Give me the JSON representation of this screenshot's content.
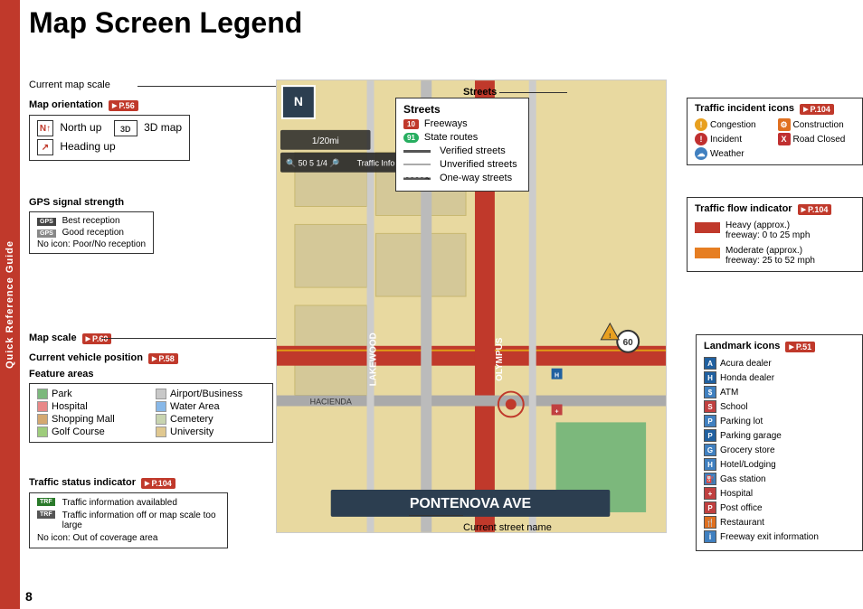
{
  "page": {
    "title": "Map Screen Legend",
    "page_number": "8",
    "side_tab": "Quick Reference Guide"
  },
  "left_panel": {
    "current_map_scale_label": "Current map scale",
    "map_orientation_label": "Map orientation",
    "map_orientation_ref": "P.56",
    "north_up_label": "North up",
    "three_d_map_label": "3D map",
    "heading_up_label": "Heading up",
    "gps_signal_label": "GPS signal strength",
    "gps_best": "Best reception",
    "gps_good": "Good reception",
    "gps_none": "No icon: Poor/No reception",
    "map_scale_label": "Map scale",
    "map_scale_ref": "P.60",
    "vehicle_position_label": "Current vehicle position",
    "vehicle_position_ref": "P.58",
    "feature_areas_label": "Feature areas",
    "features": [
      {
        "name": "Park",
        "color": "#7cb87c"
      },
      {
        "name": "Airport/Business",
        "color": "#c8c8c8"
      },
      {
        "name": "Hospital",
        "color": "#e88888"
      },
      {
        "name": "Water Area",
        "color": "#88b8e8"
      },
      {
        "name": "Shopping Mall",
        "color": "#d4a870"
      },
      {
        "name": "Cemetery",
        "color": "#c8d4b0"
      },
      {
        "name": "Golf Course",
        "color": "#9ecc7c"
      },
      {
        "name": "University",
        "color": "#e0c890"
      }
    ],
    "traffic_status_label": "Traffic status indicator",
    "traffic_status_ref": "P.104",
    "traffic_available": "Traffic information availabled",
    "traffic_off": "Traffic information off or map scale too large",
    "traffic_none": "No icon: Out of coverage area"
  },
  "streets_panel": {
    "title": "Streets",
    "rows": [
      {
        "icon_type": "freeway",
        "icon_text": "10",
        "label": "Freeways"
      },
      {
        "icon_type": "state",
        "icon_text": "91",
        "label": "State routes"
      },
      {
        "icon_type": "line_dark",
        "label": "Verified streets"
      },
      {
        "icon_type": "line_light",
        "label": "Unverified streets"
      },
      {
        "icon_type": "line_oneway",
        "label": "One-way streets"
      }
    ]
  },
  "traffic_incidents": {
    "title": "Traffic incident icons",
    "ref": "P.104",
    "items": [
      {
        "label": "Congestion",
        "color": "#e8a020"
      },
      {
        "label": "Construction",
        "color": "#e07020"
      },
      {
        "label": "Incident",
        "color": "#c03030"
      },
      {
        "label": "Road Closed",
        "color": "#c03030"
      },
      {
        "label": "Weather",
        "color": "#4080c0"
      }
    ]
  },
  "traffic_flow": {
    "title": "Traffic flow indicator",
    "ref": "P.104",
    "items": [
      {
        "label": "Heavy (approx.)",
        "sublabel": "freeway: 0 to 25 mph",
        "color": "#c0392b"
      },
      {
        "label": "Moderate (approx.)",
        "sublabel": "freeway: 25 to 52 mph",
        "color": "#e67e22"
      }
    ]
  },
  "landmark_icons": {
    "title": "Landmark icons",
    "ref": "P.51",
    "items": [
      {
        "icon": "A",
        "color": "#2060a0",
        "label": "Acura dealer"
      },
      {
        "icon": "H",
        "color": "#2060a0",
        "label": "Honda dealer"
      },
      {
        "icon": "$",
        "color": "#4080c0",
        "label": "ATM"
      },
      {
        "icon": "S",
        "color": "#c04040",
        "label": "School"
      },
      {
        "icon": "P",
        "color": "#4080c0",
        "label": "Parking lot"
      },
      {
        "icon": "P",
        "color": "#2060a0",
        "label": "Parking garage"
      },
      {
        "icon": "G",
        "color": "#4080c0",
        "label": "Grocery store"
      },
      {
        "icon": "H",
        "color": "#4080c0",
        "label": "Hotel/Lodging"
      },
      {
        "icon": "⛽",
        "color": "#4080c0",
        "label": "Gas station"
      },
      {
        "icon": "+",
        "color": "#c04040",
        "label": "Hospital"
      },
      {
        "icon": "P",
        "color": "#c04040",
        "label": "Post office"
      },
      {
        "icon": "🍴",
        "color": "#e07020",
        "label": "Restaurant"
      },
      {
        "icon": "i",
        "color": "#4080c0",
        "label": "Freeway exit information"
      }
    ]
  },
  "map_ui": {
    "compass": "N",
    "scale": "1/20mi",
    "toolbar_scale": "1/20mi",
    "toolbar_items": [
      "🔍",
      "50",
      "5",
      "1/4",
      "🔎"
    ],
    "traffic_info": "Traffic Info",
    "street_name": "PONTENOVA AVE"
  },
  "callouts": {
    "current_street_name": "Current street name"
  }
}
